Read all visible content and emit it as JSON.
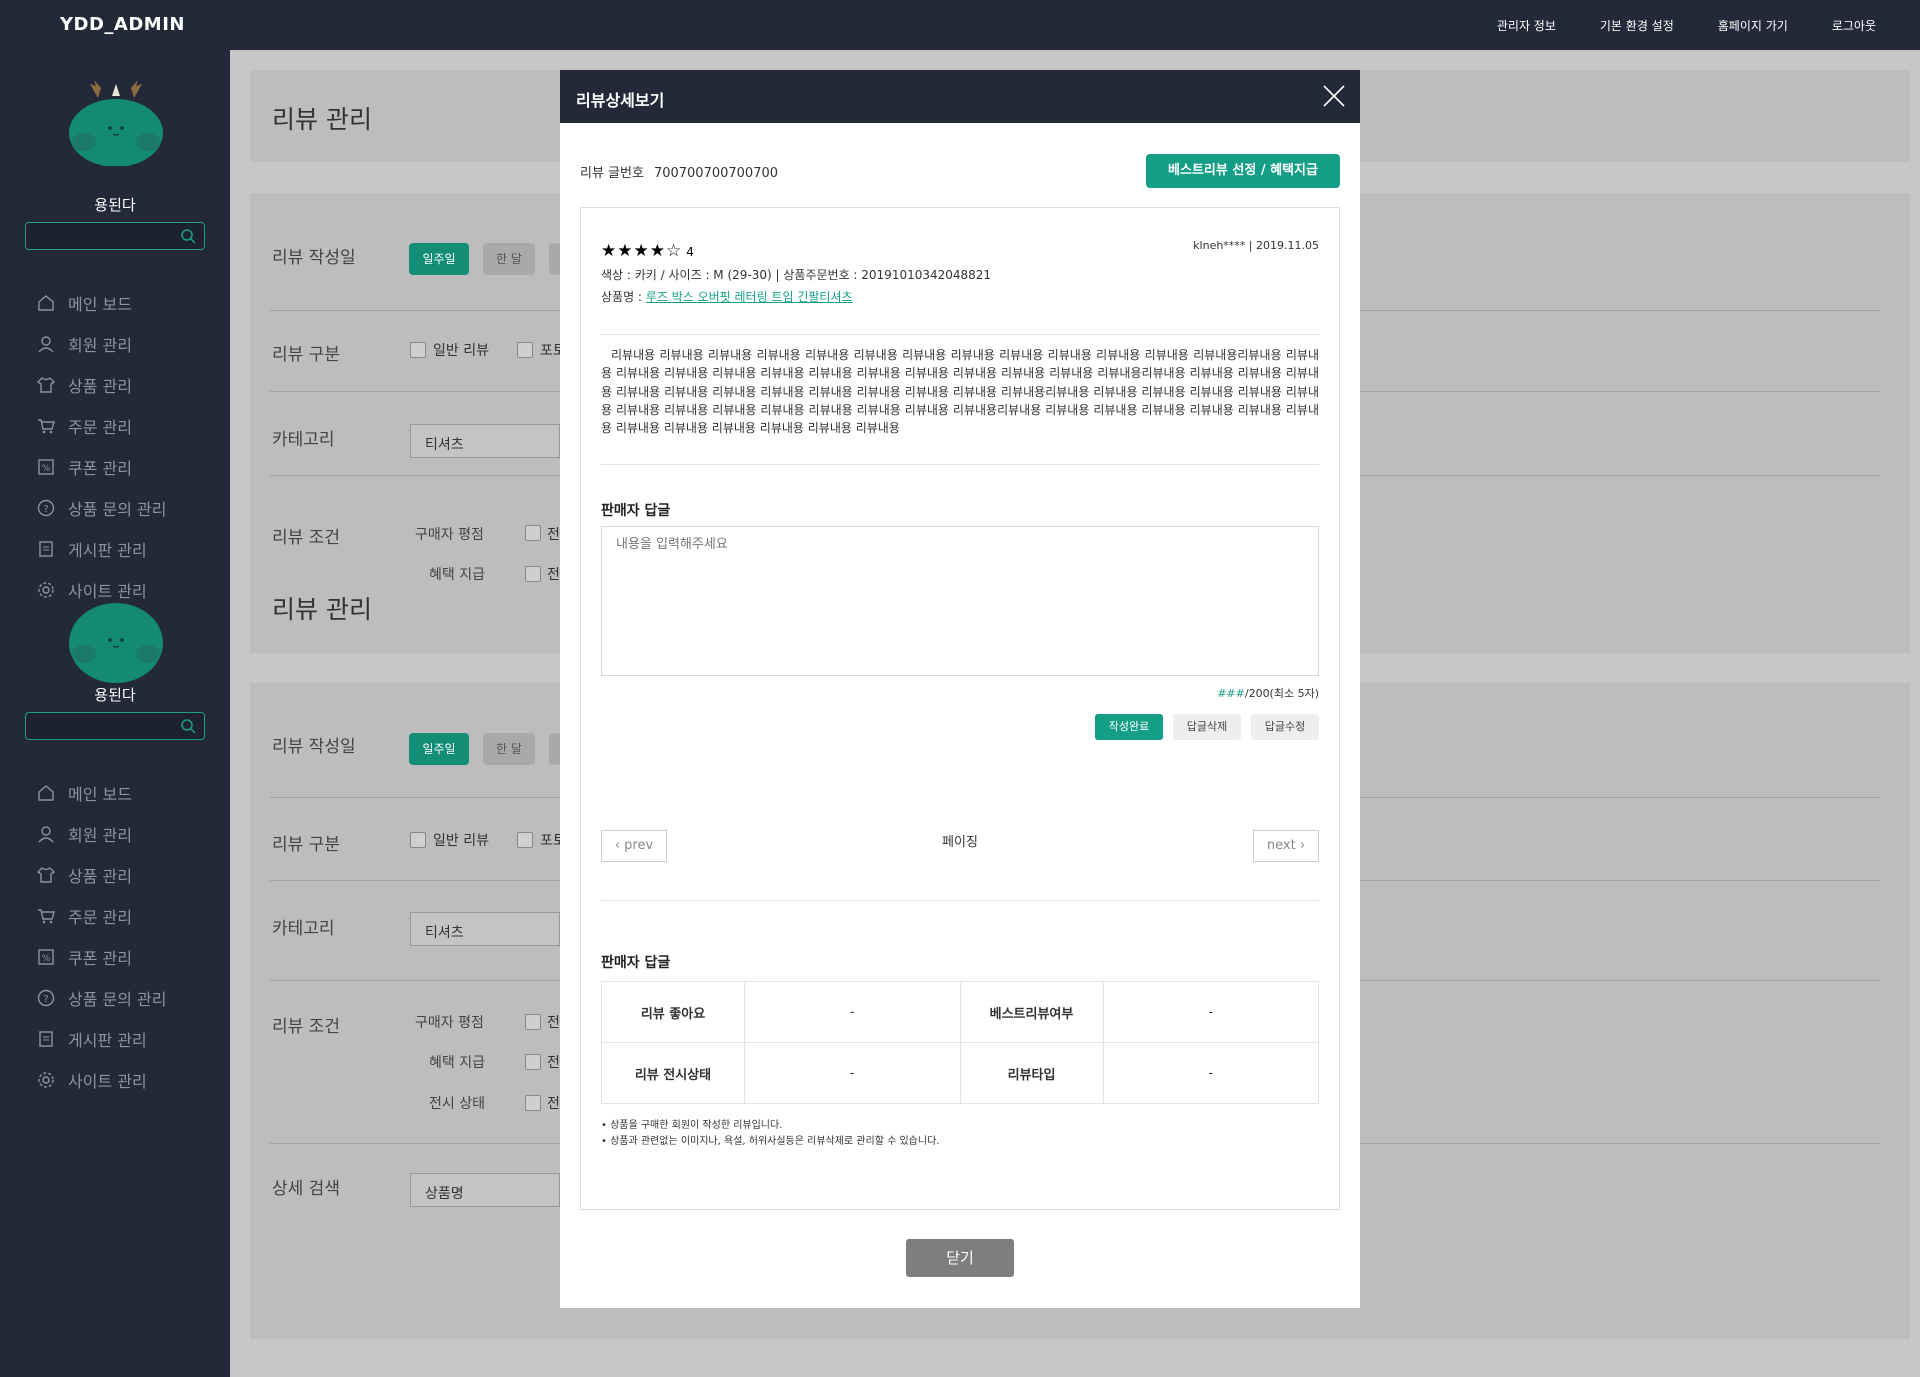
{
  "topbar": {
    "logo": "YDD_ADMIN",
    "nav": [
      "관리자 정보",
      "기본 환경 설정",
      "홈페이지 가기",
      "로그아웃"
    ]
  },
  "sidebar": {
    "user_name": "용된다",
    "menu": [
      "메인 보드",
      "회원 관리",
      "상품 관리",
      "주문 관리",
      "쿠폰 관리",
      "상품 문의 관리",
      "게시판 관리",
      "사이트 관리"
    ]
  },
  "page": {
    "title": "리뷰 관리",
    "filters": {
      "date_label": "리뷰 작성일",
      "date_buttons": [
        "일주일",
        "한 달"
      ],
      "type_label": "리뷰 구분",
      "type_options": [
        "일반 리뷰",
        "포토"
      ],
      "category_label": "카테고리",
      "category_value": "티셔츠",
      "condition_label": "리뷰 조건",
      "condition_rows": [
        "구매자 평점",
        "혜택 지급",
        "전시 상태"
      ],
      "condition_check": "전",
      "detail_label": "상세 검색",
      "detail_value": "상품명"
    }
  },
  "modal": {
    "title": "리뷰상세보기",
    "review_no_label": "리뷰 글번호",
    "review_no": "700700700700700",
    "best_button": "베스트리뷰 선정 / 혜택지급",
    "stars": "★★★★☆",
    "rating": "4",
    "meta": "klneh**** | 2019.11.05",
    "options_line": "색상 : 카키 / 사이즈 : M (29-30) | 상품주문번호 : 20191010342048821",
    "product_label": "상품명 : ",
    "product_name": "루즈 박스 오버핏 레터링 트임 긴팔티셔츠",
    "review_text": "리뷰내용 리뷰내용 리뷰내용 리뷰내용 리뷰내용 리뷰내용 리뷰내용 리뷰내용 리뷰내용 리뷰내용 리뷰내용 리뷰내용 리뷰내용리뷰내용 리뷰내용 리뷰내용 리뷰내용 리뷰내용 리뷰내용 리뷰내용 리뷰내용 리뷰내용 리뷰내용 리뷰내용 리뷰내용 리뷰내용리뷰내용 리뷰내용 리뷰내용 리뷰내용 리뷰내용 리뷰내용 리뷰내용 리뷰내용 리뷰내용 리뷰내용 리뷰내용 리뷰내용 리뷰내용리뷰내용 리뷰내용 리뷰내용 리뷰내용 리뷰내용 리뷰내용 리뷰내용 리뷰내용 리뷰내용 리뷰내용 리뷰내용 리뷰내용 리뷰내용 리뷰내용리뷰내용 리뷰내용 리뷰내용 리뷰내용 리뷰내용 리뷰내용 리뷰내용 리뷰내용 리뷰내용 리뷰내용 리뷰내용 리뷰내용 리뷰내용",
    "reply_title": "판매자 답글",
    "reply_placeholder": "내용을 입력해주세요",
    "count_value": "###",
    "count_suffix": "/200(최소 5자)",
    "btn_done": "작성완료",
    "btn_delete": "답글삭제",
    "btn_edit": "답글수정",
    "prev": "prev",
    "paging": "페이징",
    "next": "next",
    "info_title": "판매자 답글",
    "info": {
      "like_label": "리뷰 좋아요",
      "like_value": "-",
      "best_label": "베스트리뷰여부",
      "best_value": "-",
      "display_label": "리뷰 전시상태",
      "display_value": "-",
      "type_label": "리뷰타입",
      "type_value": "-"
    },
    "notes": [
      "• 상품을 구매한 회원이 작성한 리뷰입니다.",
      "• 상품과 관련없는 이미지나, 욕설, 허위사실등은 리뷰삭제로 관리할 수 있습니다."
    ],
    "close_button": "닫기"
  },
  "colors": {
    "navy": "#232938",
    "green": "#149e85",
    "overlay": "#c7c7c7"
  }
}
